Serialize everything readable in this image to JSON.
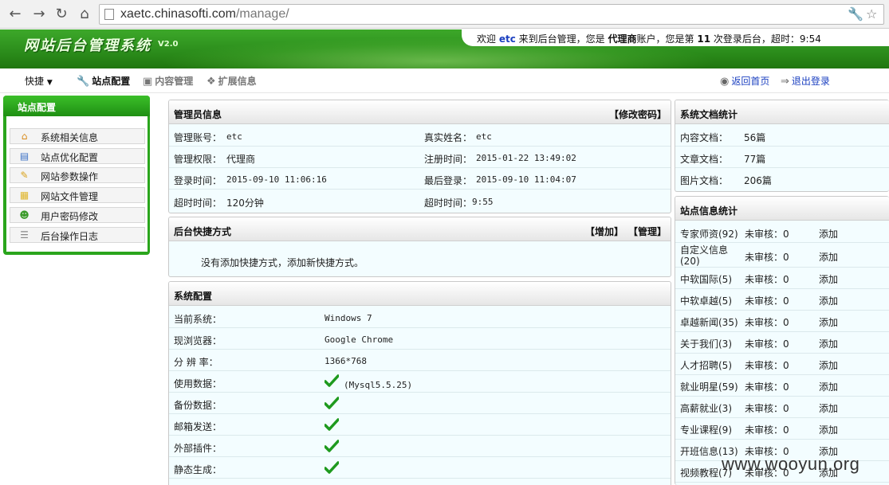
{
  "browser": {
    "url_host": "xaetc.chinasofti.com",
    "url_path": "/manage/"
  },
  "header": {
    "logo_title": "网站后台管理系统",
    "version": "V2.0",
    "welcome_pre": "欢迎",
    "username": "etc",
    "welcome_mid": "来到后台管理，您是",
    "role": "代理商",
    "welcome_mid2": "账户，您是第",
    "login_count": "11",
    "welcome_post": "次登录后台，超时：9:54"
  },
  "toolbar": {
    "quick": "快捷",
    "site_config": "站点配置",
    "content_mgmt": "内容管理",
    "ext_info": "扩展信息",
    "home": "返回首页",
    "logout": "退出登录"
  },
  "sidebar": {
    "title": "站点配置",
    "items": [
      {
        "label": "系统相关信息",
        "icon": "home-icon"
      },
      {
        "label": "站点优化配置",
        "icon": "window-icon"
      },
      {
        "label": "网站参数操作",
        "icon": "pencil-icon"
      },
      {
        "label": "网站文件管理",
        "icon": "folder-icon"
      },
      {
        "label": "用户密码修改",
        "icon": "user-icon"
      },
      {
        "label": "后台操作日志",
        "icon": "log-icon"
      }
    ]
  },
  "admin_info": {
    "title": "管理员信息",
    "action": "【修改密码】",
    "rows": [
      {
        "l1": "管理账号：",
        "v1": "etc",
        "l2": "真实姓名：",
        "v2": "etc"
      },
      {
        "l1": "管理权限：",
        "v1": "代理商",
        "l2": "注册时间：",
        "v2": "2015-01-22 13:49:02"
      },
      {
        "l1": "登录时间：",
        "v1": "2015-09-10 11:06:16",
        "l2": "最后登录：",
        "v2": "2015-09-10 11:04:07"
      },
      {
        "l1": "超时时间：",
        "v1": "120分钟",
        "l2": "超时时间：",
        "v2": "9:55"
      }
    ]
  },
  "shortcuts": {
    "title": "后台快捷方式",
    "add": "【增加】",
    "manage": "【管理】",
    "empty": "没有添加快捷方式，添加新快捷方式。"
  },
  "sys_config": {
    "title": "系统配置",
    "rows": [
      {
        "label": "当前系统：",
        "value": "Windows 7",
        "check": false
      },
      {
        "label": "现浏览器：",
        "value": "Google Chrome",
        "check": false
      },
      {
        "label": "分 辨 率：",
        "value": "1366*768",
        "check": false
      },
      {
        "label": "使用数据：",
        "value": "(Mysql5.5.25)",
        "check": true
      },
      {
        "label": "备份数据：",
        "value": "",
        "check": true
      },
      {
        "label": "邮箱发送：",
        "value": "",
        "check": true
      },
      {
        "label": "外部插件：",
        "value": "",
        "check": true
      },
      {
        "label": "静态生成：",
        "value": "",
        "check": true
      }
    ]
  },
  "doc_stats": {
    "title": "系统文档统计",
    "rows": [
      {
        "label": "内容文档：",
        "value": "56篇"
      },
      {
        "label": "文章文档：",
        "value": "77篇"
      },
      {
        "label": "图片文档：",
        "value": "206篇"
      }
    ]
  },
  "site_stats": {
    "title": "站点信息统计",
    "rows": [
      {
        "name": "专家师资(92)",
        "pending": "未审核：0",
        "action": "添加"
      },
      {
        "name": "自定义信息(20)",
        "pending": "未审核：0",
        "action": "添加"
      },
      {
        "name": "中软国际(5)",
        "pending": "未审核：0",
        "action": "添加"
      },
      {
        "name": "中软卓越(5)",
        "pending": "未审核：0",
        "action": "添加"
      },
      {
        "name": "卓越新闻(35)",
        "pending": "未审核：0",
        "action": "添加"
      },
      {
        "name": "关于我们(3)",
        "pending": "未审核：0",
        "action": "添加"
      },
      {
        "name": "人才招聘(5)",
        "pending": "未审核：0",
        "action": "添加"
      },
      {
        "name": "就业明星(59)",
        "pending": "未审核：0",
        "action": "添加"
      },
      {
        "name": "高薪就业(3)",
        "pending": "未审核：0",
        "action": "添加"
      },
      {
        "name": "专业课程(9)",
        "pending": "未审核：0",
        "action": "添加"
      },
      {
        "name": "开班信息(13)",
        "pending": "未审核：0",
        "action": "添加"
      },
      {
        "name": "视频教程(7)",
        "pending": "未审核：0",
        "action": "添加"
      }
    ]
  },
  "watermark": "www.wooyun.org"
}
